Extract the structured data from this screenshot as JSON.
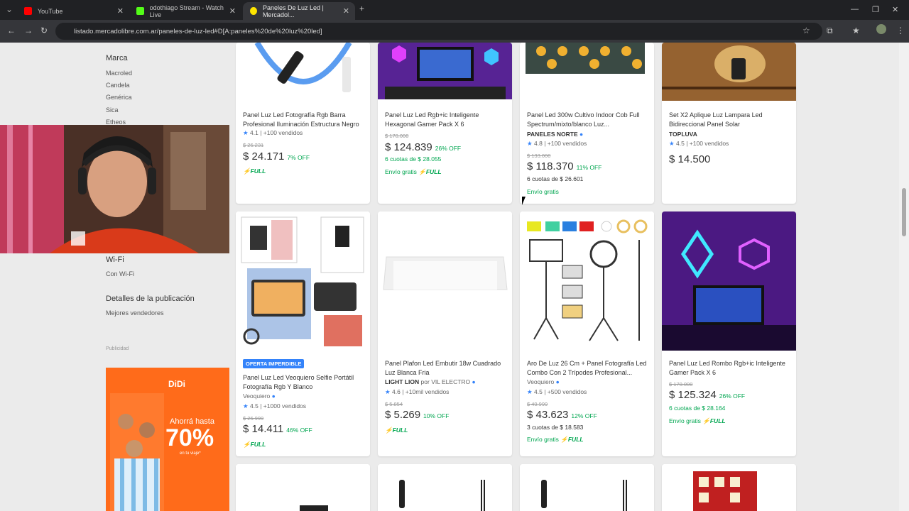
{
  "browser": {
    "tabs": [
      {
        "label": "YouTube"
      },
      {
        "label": "odothiago Stream - Watch Live"
      },
      {
        "label": "Paneles De Luz Led | Mercadol..."
      }
    ],
    "url": "listado.mercadolibre.com.ar/paneles-de-luz-led#D[A:paneles%20de%20luz%20led]"
  },
  "sidebar": {
    "marca_heading": "Marca",
    "brands": [
      "Macroled",
      "Candela",
      "Genérica",
      "Sica",
      "Etheos"
    ],
    "wifi_heading": "Wi-Fi",
    "wifi_option": "Con Wi-Fi",
    "details_heading": "Detalles de la publicación",
    "details_option": "Mejores vendedores",
    "ad_label": "Publicidad",
    "ad": {
      "logo": "DiDi",
      "line1": "Ahorrá hasta",
      "line2": "70%",
      "line3": "en tu viaje*"
    }
  },
  "products": [
    {
      "title": "Panel Luz Led Fotografía Rgb Barra Profesional Iluminación Estructura Negro",
      "rating": "4.1",
      "sold": "| +100 vendidos",
      "old_price": "$ 26.231",
      "price": "$ 24.171",
      "discount": "7% OFF",
      "full": "FULL"
    },
    {
      "title": "Panel Luz Led Rgb+ic Inteligente Hexagonal Gamer Pack X 6",
      "old_price": "$ 170.000",
      "price": "$ 124.839",
      "discount": "26% OFF",
      "installments": "6 cuotas de $ 28.055",
      "shipping": "Envío gratis",
      "full": "FULL"
    },
    {
      "title": "Panel Led 300w Cultivo Indoor Cob Full Spectrum/mixto/blanco Luz...",
      "brand": "PANELES NORTE",
      "rating": "4.8",
      "sold": "| +100 vendidos",
      "old_price": "$ 133.000",
      "price": "$ 118.370",
      "discount": "11% OFF",
      "installments": "6 cuotas de $ 26.601",
      "shipping": "Envío gratis"
    },
    {
      "title": "Set X2 Aplique Luz Lampara Led Bidireccional Panel Solar",
      "brand": "TOPLUVA",
      "rating": "4.5",
      "sold": "| +100 vendidos",
      "price": "$ 14.500"
    },
    {
      "badge": "OFERTA IMPERDIBLE",
      "title": "Panel Luz Led Veoquiero Selfie Portátil Fotografía Rgb Y Blanco",
      "seller": "Veoquiero",
      "rating": "4.5",
      "sold": "| +1000 vendidos",
      "old_price": "$ 26.999",
      "price": "$ 14.411",
      "discount": "46% OFF",
      "full": "FULL"
    },
    {
      "title": "Panel Plafon Led Embutir 18w Cuadrado Luz Blanca Fria",
      "brand": "LIGHT LION",
      "seller": "por VIL ELECTRO",
      "rating": "4.6",
      "sold": "| +10mil vendidos",
      "old_price": "$ 5.854",
      "price": "$ 5.269",
      "discount": "10% OFF",
      "full": "FULL"
    },
    {
      "title": "Aro De Luz 26 Cm + Panel Fotografía Led Combo Con 2 Trípodes Profesional...",
      "seller": "Veoquiero",
      "rating": "4.5",
      "sold": "| +500 vendidos",
      "old_price": "$ 49.999",
      "price": "$ 43.623",
      "discount": "12% OFF",
      "installments": "3 cuotas de $ 18.583",
      "shipping": "Envío gratis",
      "full": "FULL"
    },
    {
      "title": "Panel Luz Led Rombo Rgb+ic Inteligente Gamer Pack X 6",
      "old_price": "$ 170.000",
      "price": "$ 125.324",
      "discount": "26% OFF",
      "installments": "6 cuotas de $ 28.164",
      "shipping": "Envío gratis",
      "full": "FULL"
    }
  ],
  "colors": {
    "green": "#00a650",
    "blue": "#3483fa",
    "ad_orange": "#ff6b1a"
  }
}
